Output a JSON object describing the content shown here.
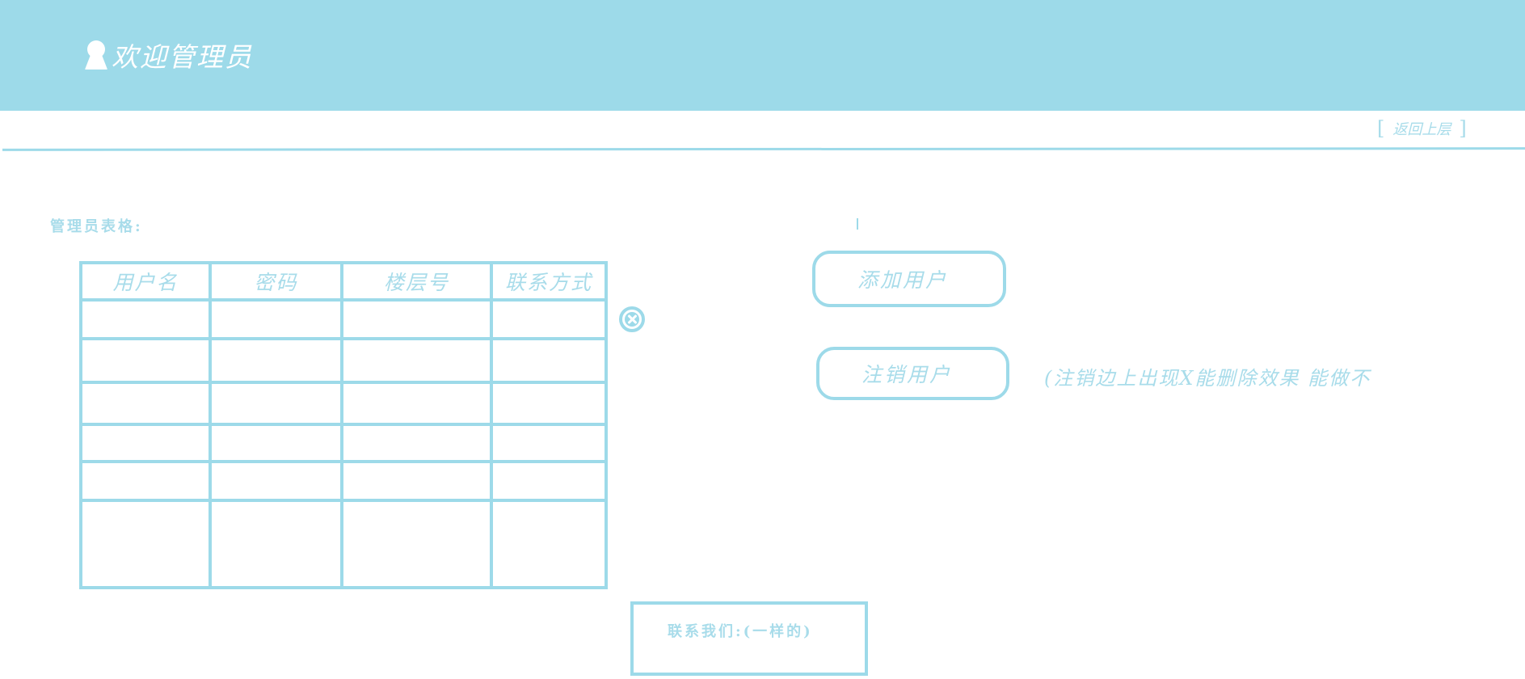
{
  "colors": {
    "accent": "#9ddae9",
    "text": "#a8dcea",
    "background": "#ffffff",
    "header_text": "#ffffff"
  },
  "header": {
    "icon": "user-icon",
    "welcome_text": "欢迎管理员"
  },
  "nav": {
    "back_label": "返回上层",
    "bracket_open": "[",
    "bracket_close": "]"
  },
  "table": {
    "caption": "管理员表格:",
    "columns": [
      "用户名",
      "密码",
      "楼层号",
      "联系方式"
    ],
    "row_count": 6
  },
  "actions": {
    "add_user_label": "添加用户",
    "remove_user_label": "注销用户",
    "remove_note": "(注销边上出现X能删除效果 能做不",
    "delete_icon": "close-circle-icon"
  },
  "footer": {
    "contact_text": "联系我们:(一样的)"
  }
}
